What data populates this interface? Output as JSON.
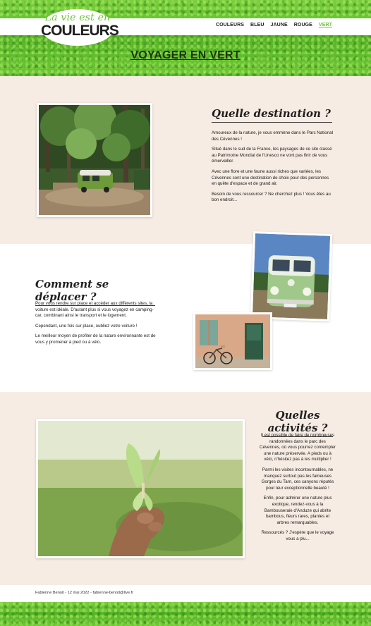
{
  "header": {
    "logo_script": "La vie est en",
    "logo_main": "COULEURS",
    "nav": [
      "COULEURS",
      "BLEU",
      "JAUNE",
      "ROUGE",
      "VERT"
    ],
    "active_nav": "VERT",
    "page_title": "VOYAGER EN VERT"
  },
  "sections": {
    "destination": {
      "heading": "Quelle destination ?",
      "paragraphs": [
        "Amoureux de la nature, je vous emmène dans le Parc National des Cévennes !",
        "Situé dans le sud de la France, les paysages de ce site classé au Patrimoine Mondial de l'Unesco ne vont pas finir de vous émerveiller.",
        "Avec une flore et une faune aussi riches que variées, les Cévennes sont une destination de choix pour des personnes en quête d'espace et de grand air.",
        "Besoin de vous ressourcer ? Ne cherchez plus ! Vous êtes au bon endroit..."
      ]
    },
    "transport": {
      "heading": "Comment se déplacer ?",
      "paragraphs": [
        "Pour vous rendre sur place et accéder aux différents sites, la voiture est idéale. D'autant plus si vous voyagez en camping-car, combinant ainsi le transport et le logement.",
        "Cependant, une fois sur place, oubliez votre voiture !",
        "Le meilleur moyen de profiter de la nature environnante est de vous y promener à pied ou à vélo."
      ]
    },
    "activities": {
      "heading": "Quelles activités ?",
      "paragraphs": [
        "Il est possible de faire de nombreuses randonnées dans le parc des Cévennes, où vous pourrez contempler une nature préservée. A pieds ou à vélo, n'hésitez pas à les multiplier !",
        "Parmi les visites incontournables, ne manquez surtout pas les fameuses Gorges du Tarn, ces canyons réputés pour leur exceptionnelle beauté !",
        "Enfin, pour admirer une nature plus exotique, rendez-vous à la Bambouseraie d'Anduze qui abrite bambous, fleurs rares, plantes et arbres remarquables.",
        "Ressourcés ? J'espère que le voyage vous a plu..."
      ]
    }
  },
  "footer": {
    "text": "Fabienne Benoit - 12 mai 2022 - fabienne-benoit@live.fr"
  },
  "colors": {
    "accent_green": "#6fc538",
    "beige": "#f6ece3",
    "title_dark": "#1f3212"
  },
  "images": {
    "forest_van": "photo-forest-van",
    "van_front": "photo-van-front",
    "bike_door": "photo-bike-door",
    "butterfly_hand": "photo-butterfly-hand"
  }
}
